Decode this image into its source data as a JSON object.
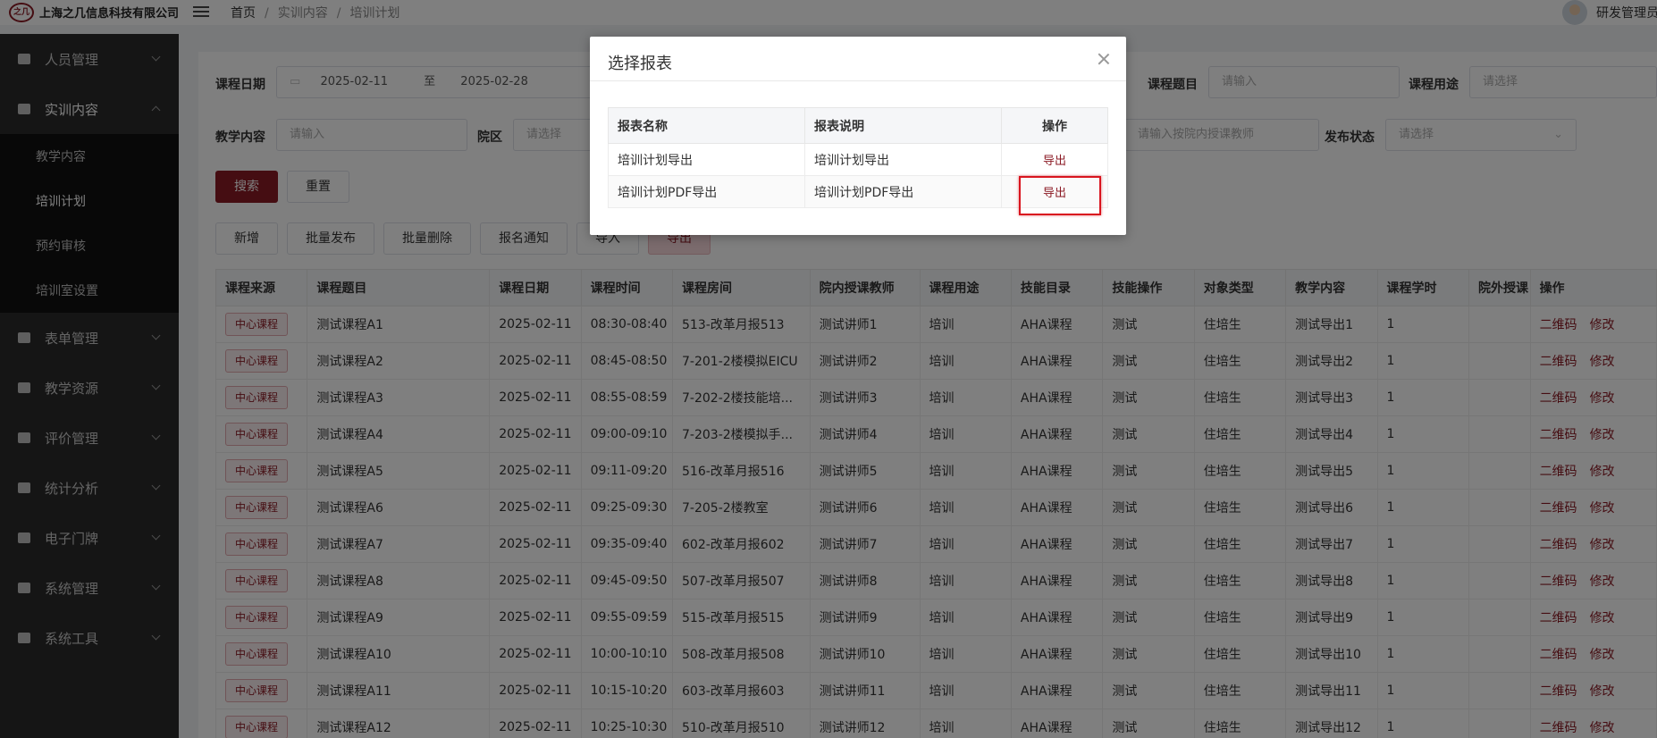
{
  "topbar": {
    "logo_text": "之几",
    "company": "上海之几信息科技有限公司",
    "breadcrumb": [
      "首页",
      "实训内容",
      "培训计划"
    ],
    "user_name": "研发管理员"
  },
  "sidebar": {
    "items": [
      {
        "label": "人员管理",
        "icon": "users-icon"
      },
      {
        "label": "实训内容",
        "icon": "training-icon",
        "open": true
      },
      {
        "label": "表单管理",
        "icon": "form-icon"
      },
      {
        "label": "教学资源",
        "icon": "resource-icon"
      },
      {
        "label": "评价管理",
        "icon": "evaluate-icon"
      },
      {
        "label": "统计分析",
        "icon": "chart-icon"
      },
      {
        "label": "电子门牌",
        "icon": "monitor-icon"
      },
      {
        "label": "系统管理",
        "icon": "gear-icon"
      },
      {
        "label": "系统工具",
        "icon": "toolbox-icon"
      }
    ],
    "subitems": [
      "教学内容",
      "培训计划",
      "预约审核",
      "培训室设置"
    ],
    "active_sub": "培训计划"
  },
  "filters": {
    "course_date_label": "课程日期",
    "date_start": "2025-02-11",
    "date_to": "至",
    "date_end": "2025-02-28",
    "course_title_label": "课程题目",
    "course_title_placeholder": "请输入",
    "course_use_label": "课程用途",
    "course_use_placeholder": "请选择",
    "teaching_content_label": "教学内容",
    "teaching_content_placeholder": "请输入",
    "district_label": "院区",
    "district_placeholder": "请选择",
    "teacher_placeholder": "请输入按院内授课教师",
    "publish_status_label": "发布状态",
    "publish_status_placeholder": "请选择",
    "search": "搜索",
    "reset": "重置"
  },
  "actions": {
    "add": "新增",
    "batch_publish": "批量发布",
    "batch_delete": "批量删除",
    "signup_notice": "报名通知",
    "import": "导入",
    "export": "导出"
  },
  "table": {
    "headers": [
      "课程来源",
      "课程题目",
      "课程日期",
      "课程时间",
      "课程房间",
      "院内授课教师",
      "课程用途",
      "技能目录",
      "技能操作",
      "对象类型",
      "教学内容",
      "课程学时",
      "院外授课",
      "操作"
    ],
    "tag": "中心课程",
    "op_qr": "二维码",
    "op_edit": "修改",
    "rows": [
      {
        "title": "测试课程A1",
        "date": "2025-02-11",
        "time": "08:30-08:40",
        "room": "513-改革月报513",
        "teacher": "测试讲师1",
        "use": "培训",
        "skill": "AHA课程",
        "op": "测试",
        "target": "住培生",
        "content": "测试导出1",
        "hours": "1"
      },
      {
        "title": "测试课程A2",
        "date": "2025-02-11",
        "time": "08:45-08:50",
        "room": "7-201-2楼模拟EICU",
        "teacher": "测试讲师2",
        "use": "培训",
        "skill": "AHA课程",
        "op": "测试",
        "target": "住培生",
        "content": "测试导出2",
        "hours": "1"
      },
      {
        "title": "测试课程A3",
        "date": "2025-02-11",
        "time": "08:55-08:59",
        "room": "7-202-2楼技能培...",
        "teacher": "测试讲师3",
        "use": "培训",
        "skill": "AHA课程",
        "op": "测试",
        "target": "住培生",
        "content": "测试导出3",
        "hours": "1"
      },
      {
        "title": "测试课程A4",
        "date": "2025-02-11",
        "time": "09:00-09:10",
        "room": "7-203-2楼模拟手...",
        "teacher": "测试讲师4",
        "use": "培训",
        "skill": "AHA课程",
        "op": "测试",
        "target": "住培生",
        "content": "测试导出4",
        "hours": "1"
      },
      {
        "title": "测试课程A5",
        "date": "2025-02-11",
        "time": "09:11-09:20",
        "room": "516-改革月报516",
        "teacher": "测试讲师5",
        "use": "培训",
        "skill": "AHA课程",
        "op": "测试",
        "target": "住培生",
        "content": "测试导出5",
        "hours": "1"
      },
      {
        "title": "测试课程A6",
        "date": "2025-02-11",
        "time": "09:25-09:30",
        "room": "7-205-2楼教室",
        "teacher": "测试讲师6",
        "use": "培训",
        "skill": "AHA课程",
        "op": "测试",
        "target": "住培生",
        "content": "测试导出6",
        "hours": "1"
      },
      {
        "title": "测试课程A7",
        "date": "2025-02-11",
        "time": "09:35-09:40",
        "room": "602-改革月报602",
        "teacher": "测试讲师7",
        "use": "培训",
        "skill": "AHA课程",
        "op": "测试",
        "target": "住培生",
        "content": "测试导出7",
        "hours": "1"
      },
      {
        "title": "测试课程A8",
        "date": "2025-02-11",
        "time": "09:45-09:50",
        "room": "507-改革月报507",
        "teacher": "测试讲师8",
        "use": "培训",
        "skill": "AHA课程",
        "op": "测试",
        "target": "住培生",
        "content": "测试导出8",
        "hours": "1"
      },
      {
        "title": "测试课程A9",
        "date": "2025-02-11",
        "time": "09:55-09:59",
        "room": "515-改革月报515",
        "teacher": "测试讲师9",
        "use": "培训",
        "skill": "AHA课程",
        "op": "测试",
        "target": "住培生",
        "content": "测试导出9",
        "hours": "1"
      },
      {
        "title": "测试课程A10",
        "date": "2025-02-11",
        "time": "10:00-10:10",
        "room": "508-改革月报508",
        "teacher": "测试讲师10",
        "use": "培训",
        "skill": "AHA课程",
        "op": "测试",
        "target": "住培生",
        "content": "测试导出10",
        "hours": "1"
      },
      {
        "title": "测试课程A11",
        "date": "2025-02-11",
        "time": "10:15-10:20",
        "room": "603-改革月报603",
        "teacher": "测试讲师11",
        "use": "培训",
        "skill": "AHA课程",
        "op": "测试",
        "target": "住培生",
        "content": "测试导出11",
        "hours": "1"
      },
      {
        "title": "测试课程A12",
        "date": "2025-02-11",
        "time": "10:25-10:30",
        "room": "510-改革月报510",
        "teacher": "测试讲师12",
        "use": "培训",
        "skill": "AHA课程",
        "op": "测试",
        "target": "住培生",
        "content": "测试导出12",
        "hours": "1"
      }
    ]
  },
  "modal": {
    "title": "选择报表",
    "headers": [
      "报表名称",
      "报表说明",
      "操作"
    ],
    "rows": [
      {
        "name": "培训计划导出",
        "desc": "培训计划导出",
        "action": "导出"
      },
      {
        "name": "培训计划PDF导出",
        "desc": "培训计划PDF导出",
        "action": "导出"
      }
    ]
  },
  "colors": {
    "brand": "#8b1a24",
    "highlight": "#d9141e"
  }
}
